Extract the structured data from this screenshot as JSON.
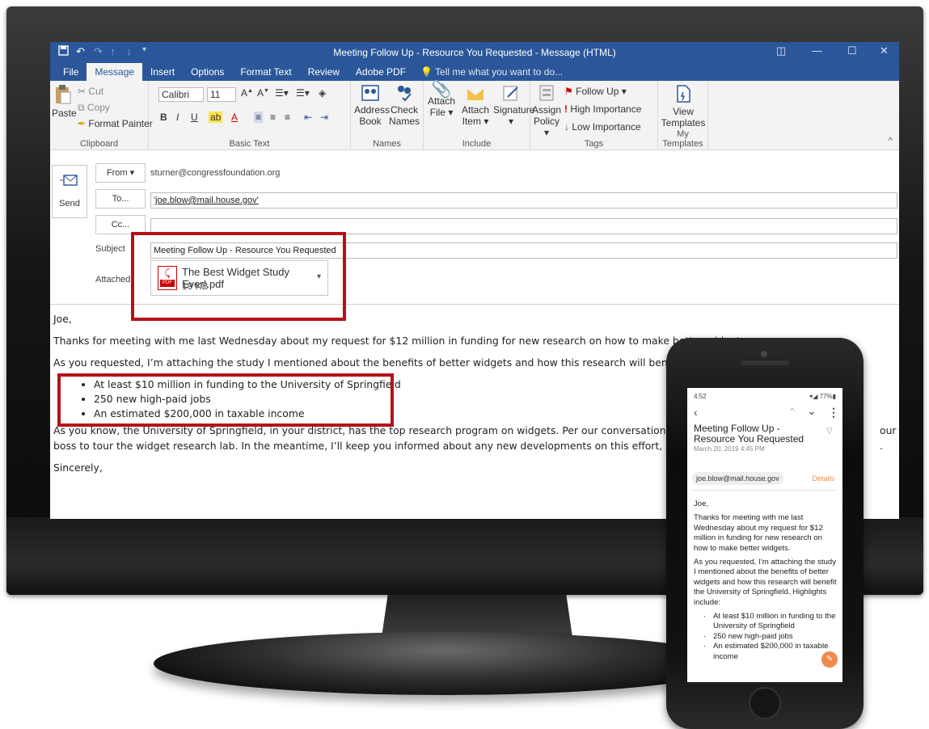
{
  "window": {
    "title": "Meeting Follow Up - Resource You Requested  - Message (HTML)"
  },
  "tabs": [
    "File",
    "Message",
    "Insert",
    "Options",
    "Format Text",
    "Review",
    "Adobe PDF"
  ],
  "tell_me": "Tell me what you want to do...",
  "ribbon": {
    "clipboard": {
      "paste": "Paste",
      "cut": "Cut",
      "copy": "Copy",
      "format_painter": "Format Painter",
      "label": "Clipboard"
    },
    "basic_text": {
      "font": "Calibri",
      "size": "11",
      "label": "Basic Text"
    },
    "names": {
      "address_book_1": "Address",
      "address_book_2": "Book",
      "check_names_1": "Check",
      "check_names_2": "Names",
      "label": "Names"
    },
    "include": {
      "attach_file_1": "Attach",
      "attach_file_2": "File",
      "attach_item_1": "Attach",
      "attach_item_2": "Item",
      "signature": "Signature",
      "label": "Include"
    },
    "tags": {
      "assign_policy_1": "Assign",
      "assign_policy_2": "Policy",
      "follow_up": "Follow Up",
      "high_importance": "High Importance",
      "low_importance": "Low Importance",
      "label": "Tags"
    },
    "templates": {
      "view_1": "View",
      "view_2": "Templates",
      "label": "My Templates"
    }
  },
  "header": {
    "send": "Send",
    "from_label": "From",
    "from_value": "sturner@congressfoundation.org",
    "to_label": "To...",
    "to_value": "'joe.blow@mail.house.gov'",
    "cc_label": "Cc...",
    "cc_value": "",
    "subject_label": "Subject",
    "subject_value": "Meeting Follow Up - Resource You Requested",
    "attached_label": "Attached",
    "attachment_name": "The Best Widget Study Ever!.pdf",
    "attachment_size": "19 KB",
    "pdf_badge": "PDF"
  },
  "body": {
    "greeting": "Joe,",
    "p1": "Thanks for meeting with me last Wednesday about my request for $12 million in funding for new research on how to make better widgets.",
    "p2": "As you requested, I’m attaching the study I mentioned about the benefits of better widgets and how this research will benefit the Univers",
    "bullets": [
      "At least $10 million in funding to the University of Springfield",
      "250 new high-paid jobs",
      "An estimated $200,000 in taxable income"
    ],
    "p3a": "As you know, the University of Springfield, in your district, has the top research program on widgets. Per our conversation, I’ve contacted",
    "p3a_tail": "our",
    "p3b": "boss to tour the widget research lab. In the meantime, I’ll keep you informed about any new developments on this effort, and please feel",
    "p3b_tail": ".",
    "closing": "Sincerely,"
  },
  "phone": {
    "time": "4:52",
    "battery": "77%",
    "subject": "Meeting Follow Up - Resource You Requested",
    "date": "March 20, 2019  4:45 PM",
    "to": "joe.blow@mail.house.gov",
    "details": "Details",
    "greeting": "Joe,",
    "p1": "Thanks for meeting with me last Wednesday about my request for $12 million in funding for new research on how to make better widgets.",
    "p2": "As you requested, I’m attaching the study I mentioned about the benefits of better widgets and how this research will benefit the University of Springfield. Highlights include:",
    "bullets": [
      "At least $10 million in funding to the University of Springfield",
      "250 new high-paid jobs",
      "An estimated $200,000 in taxable income"
    ]
  },
  "colors": {
    "outlook_blue": "#2b579a",
    "highlight_red": "#b51218",
    "phone_accent": "#f08a4b"
  }
}
